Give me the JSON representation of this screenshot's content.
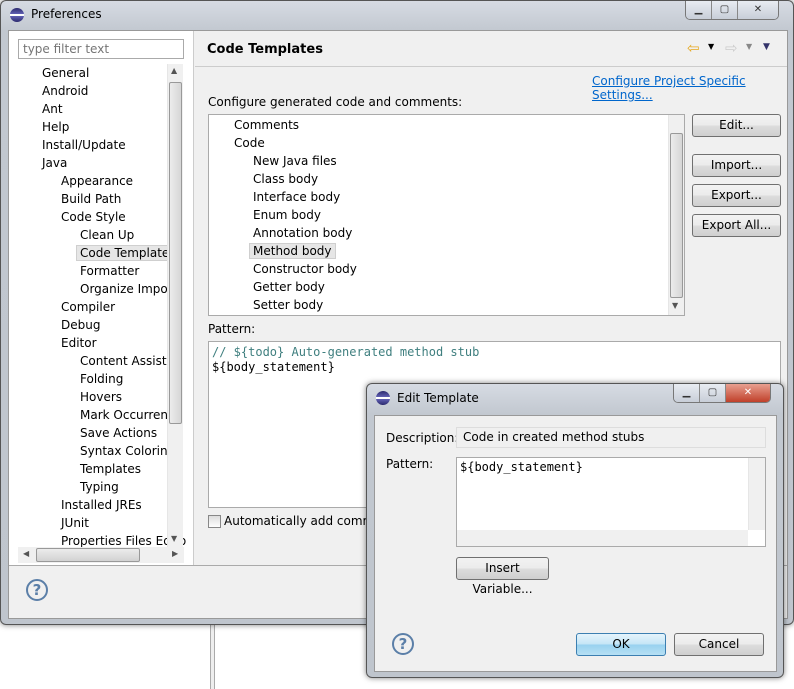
{
  "preferences": {
    "title": "Preferences",
    "filter_placeholder": "type filter text",
    "tree": [
      {
        "label": "General",
        "level": 0
      },
      {
        "label": "Android",
        "level": 0
      },
      {
        "label": "Ant",
        "level": 0
      },
      {
        "label": "Help",
        "level": 0
      },
      {
        "label": "Install/Update",
        "level": 0
      },
      {
        "label": "Java",
        "level": 0
      },
      {
        "label": "Appearance",
        "level": 1
      },
      {
        "label": "Build Path",
        "level": 1
      },
      {
        "label": "Code Style",
        "level": 1
      },
      {
        "label": "Clean Up",
        "level": 2
      },
      {
        "label": "Code Templates",
        "level": 2,
        "selected": true
      },
      {
        "label": "Formatter",
        "level": 2
      },
      {
        "label": "Organize Import",
        "level": 2
      },
      {
        "label": "Compiler",
        "level": 1
      },
      {
        "label": "Debug",
        "level": 1
      },
      {
        "label": "Editor",
        "level": 1
      },
      {
        "label": "Content Assist",
        "level": 2
      },
      {
        "label": "Folding",
        "level": 2
      },
      {
        "label": "Hovers",
        "level": 2
      },
      {
        "label": "Mark Occurrence",
        "level": 2
      },
      {
        "label": "Save Actions",
        "level": 2
      },
      {
        "label": "Syntax Coloring",
        "level": 2
      },
      {
        "label": "Templates",
        "level": 2
      },
      {
        "label": "Typing",
        "level": 2
      },
      {
        "label": "Installed JREs",
        "level": 1
      },
      {
        "label": "JUnit",
        "level": 1
      },
      {
        "label": "Properties Files Edito",
        "level": 1
      }
    ],
    "page_title": "Code Templates",
    "project_link": "Configure Project Specific Settings...",
    "configure_label": "Configure generated code and comments:",
    "templates": [
      {
        "label": "Comments",
        "level": 0
      },
      {
        "label": "Code",
        "level": 0
      },
      {
        "label": "New Java files",
        "level": 1
      },
      {
        "label": "Class body",
        "level": 1
      },
      {
        "label": "Interface body",
        "level": 1
      },
      {
        "label": "Enum body",
        "level": 1
      },
      {
        "label": "Annotation body",
        "level": 1
      },
      {
        "label": "Method body",
        "level": 1,
        "selected": true
      },
      {
        "label": "Constructor body",
        "level": 1
      },
      {
        "label": "Getter body",
        "level": 1
      },
      {
        "label": "Setter body",
        "level": 1
      }
    ],
    "buttons": {
      "edit": "Edit...",
      "import": "Import...",
      "export": "Export...",
      "export_all": "Export All..."
    },
    "pattern_label": "Pattern:",
    "pattern_lines": [
      "// ${todo} Auto-generated method stub",
      "${body_statement}"
    ],
    "auto_comments_label": "Automatically add commen",
    "auto_comments_checked": false,
    "comment_color": "#3f7f7f"
  },
  "edit_template": {
    "title": "Edit Template",
    "description_label": "Description:",
    "description_value": "Code in created method stubs",
    "pattern_label": "Pattern:",
    "pattern_value": "${body_statement}",
    "insert_variable": "Insert Variable...",
    "ok": "OK",
    "cancel": "Cancel"
  },
  "link_color": "#0066cc"
}
